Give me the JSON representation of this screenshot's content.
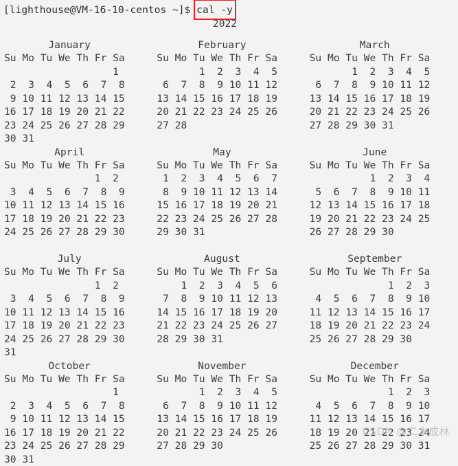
{
  "terminal": {
    "background_color": "#f3f3f3",
    "text_color": "#3b3b3b",
    "highlight_box_color": "#ef1f1f",
    "prompt": "[lighthouse@VM-16-10-centos ~]$ ",
    "command": "cal -y",
    "year": "2022"
  },
  "calendar": {
    "weekday_header": "Su Mo Tu We Th Fr Sa",
    "rows": [
      {
        "months": [
          {
            "name": "January",
            "weeks": [
              "                  1",
              " 2  3  4  5  6  7  8",
              " 9 10 11 12 13 14 15",
              "16 17 18 19 20 21 22",
              "23 24 25 26 27 28 29",
              "30 31"
            ]
          },
          {
            "name": "February",
            "weeks": [
              "       1  2  3  4  5",
              " 6  7  8  9 10 11 12",
              "13 14 15 16 17 18 19",
              "20 21 22 23 24 25 26",
              "27 28",
              ""
            ]
          },
          {
            "name": "March",
            "weeks": [
              "       1  2  3  4  5",
              " 6  7  8  9 10 11 12",
              "13 14 15 16 17 18 19",
              "20 21 22 23 24 25 26",
              "27 28 29 30 31",
              ""
            ]
          }
        ]
      },
      {
        "months": [
          {
            "name": "April",
            "weeks": [
              "               1  2",
              " 3  4  5  6  7  8  9",
              "10 11 12 13 14 15 16",
              "17 18 19 20 21 22 23",
              "24 25 26 27 28 29 30",
              ""
            ]
          },
          {
            "name": "May",
            "weeks": [
              " 1  2  3  4  5  6  7",
              " 8  9 10 11 12 13 14",
              "15 16 17 18 19 20 21",
              "22 23 24 25 26 27 28",
              "29 30 31",
              ""
            ]
          },
          {
            "name": "June",
            "weeks": [
              "          1  2  3  4",
              " 5  6  7  8  9 10 11",
              "12 13 14 15 16 17 18",
              "19 20 21 22 23 24 25",
              "26 27 28 29 30",
              ""
            ]
          }
        ]
      },
      {
        "months": [
          {
            "name": "July",
            "weeks": [
              "               1  2",
              " 3  4  5  6  7  8  9",
              "10 11 12 13 14 15 16",
              "17 18 19 20 21 22 23",
              "24 25 26 27 28 29 30",
              "31"
            ]
          },
          {
            "name": "August",
            "weeks": [
              "    1  2  3  4  5  6",
              " 7  8  9 10 11 12 13",
              "14 15 16 17 18 19 20",
              "21 22 23 24 25 26 27",
              "28 29 30 31",
              ""
            ]
          },
          {
            "name": "September",
            "weeks": [
              "             1  2  3",
              " 4  5  6  7  8  9 10",
              "11 12 13 14 15 16 17",
              "18 19 20 21 22 23 24",
              "25 26 27 28 29 30",
              ""
            ]
          }
        ]
      },
      {
        "months": [
          {
            "name": "October",
            "weeks": [
              "                  1",
              " 2  3  4  5  6  7  8",
              " 9 10 11 12 13 14 15",
              "16 17 18 19 20 21 22",
              "23 24 25 26 27 28 29",
              "30 31"
            ]
          },
          {
            "name": "November",
            "weeks": [
              "       1  2  3  4  5",
              " 6  7  8  9 10 11 12",
              "13 14 15 16 17 18 19",
              "20 21 22 23 24 25 26",
              "27 28 29 30",
              ""
            ]
          },
          {
            "name": "December",
            "weeks": [
              "             1  2  3",
              " 4  5  6  7  8  9 10",
              "11 12 13 14 15 16 17",
              "18 19 20 21 22 23 24",
              "25 26 27 28 29 30 31",
              ""
            ]
          }
        ]
      }
    ]
  },
  "watermark": {
    "text": "CSDN @二木成林"
  }
}
